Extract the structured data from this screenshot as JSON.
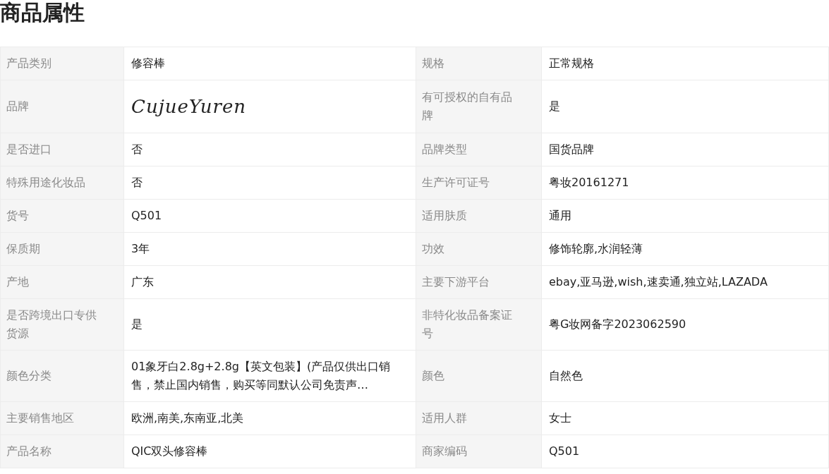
{
  "title": "商品属性",
  "rows": [
    [
      {
        "label": "产品类别",
        "value": "修容棒",
        "kind": "text"
      },
      {
        "label": "规格",
        "value": "正常规格",
        "kind": "text"
      }
    ],
    [
      {
        "label": "品牌",
        "value": "CujueYuren",
        "kind": "logo"
      },
      {
        "label": "有可授权的自有品牌",
        "value": "是",
        "kind": "text"
      }
    ],
    [
      {
        "label": "是否进口",
        "value": "否",
        "kind": "text"
      },
      {
        "label": "品牌类型",
        "value": "国货品牌",
        "kind": "text"
      }
    ],
    [
      {
        "label": "特殊用途化妆品",
        "value": "否",
        "kind": "text"
      },
      {
        "label": "生产许可证号",
        "value": "粤妆20161271",
        "kind": "text"
      }
    ],
    [
      {
        "label": "货号",
        "value": "Q501",
        "kind": "text"
      },
      {
        "label": "适用肤质",
        "value": "通用",
        "kind": "text"
      }
    ],
    [
      {
        "label": "保质期",
        "value": "3年",
        "kind": "text"
      },
      {
        "label": "功效",
        "value": "修饰轮廓,水润轻薄",
        "kind": "text"
      }
    ],
    [
      {
        "label": "产地",
        "value": "广东",
        "kind": "text"
      },
      {
        "label": "主要下游平台",
        "value": "ebay,亚马逊,wish,速卖通,独立站,LAZADA",
        "kind": "text"
      }
    ],
    [
      {
        "label": "是否跨境出口专供货源",
        "value": "是",
        "kind": "text"
      },
      {
        "label": "非特化妆品备案证号",
        "value": "粤G妆网备字2023062590",
        "kind": "text"
      }
    ],
    [
      {
        "label": "颜色分类",
        "value": "01象牙白2.8g+2.8g【英文包装】(产品仅供出口销售，禁止国内销售，购买等同默认公司免责声…",
        "kind": "text"
      },
      {
        "label": "颜色",
        "value": "自然色",
        "kind": "text"
      }
    ],
    [
      {
        "label": "主要销售地区",
        "value": "欧洲,南美,东南亚,北美",
        "kind": "text"
      },
      {
        "label": "适用人群",
        "value": "女士",
        "kind": "text"
      }
    ],
    [
      {
        "label": "产品名称",
        "value": "QIC双头修容棒",
        "kind": "text"
      },
      {
        "label": "商家编码",
        "value": "Q501",
        "kind": "text"
      }
    ]
  ]
}
